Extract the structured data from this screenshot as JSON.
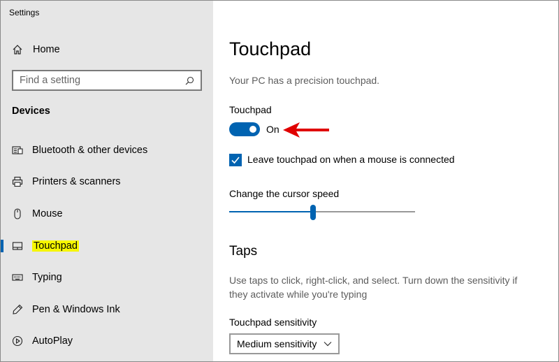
{
  "window": {
    "title": "Settings"
  },
  "sidebar": {
    "home": {
      "label": "Home",
      "icon": "home-icon"
    },
    "search": {
      "placeholder": "Find a setting",
      "value": "",
      "icon": "search-icon"
    },
    "section": "Devices",
    "items": [
      {
        "label": "Bluetooth & other devices",
        "icon": "bluetooth-devices-icon"
      },
      {
        "label": "Printers & scanners",
        "icon": "printer-icon"
      },
      {
        "label": "Mouse",
        "icon": "mouse-icon"
      },
      {
        "label": "Touchpad",
        "icon": "touchpad-icon",
        "selected": true
      },
      {
        "label": "Typing",
        "icon": "keyboard-icon"
      },
      {
        "label": "Pen & Windows Ink",
        "icon": "pen-icon"
      },
      {
        "label": "AutoPlay",
        "icon": "autoplay-icon"
      }
    ]
  },
  "main": {
    "title": "Touchpad",
    "info": "Your PC has a precision touchpad.",
    "toggle": {
      "label": "Touchpad",
      "state": "On",
      "on": true
    },
    "checkbox": {
      "label": "Leave touchpad on when a mouse is connected",
      "checked": true
    },
    "cursor_speed": {
      "label": "Change the cursor speed",
      "level": 0.45
    },
    "taps": {
      "heading": "Taps",
      "description": "Use taps to click, right-click, and select. Turn down the sensitivity if they activate while you're typing",
      "sensitivity_label": "Touchpad sensitivity",
      "sensitivity_value": "Medium sensitivity"
    }
  },
  "colors": {
    "accent": "#0063b1",
    "annotation_arrow": "#e00000",
    "highlight": "#f6f600",
    "sidebar_bg": "#e6e6e6"
  }
}
